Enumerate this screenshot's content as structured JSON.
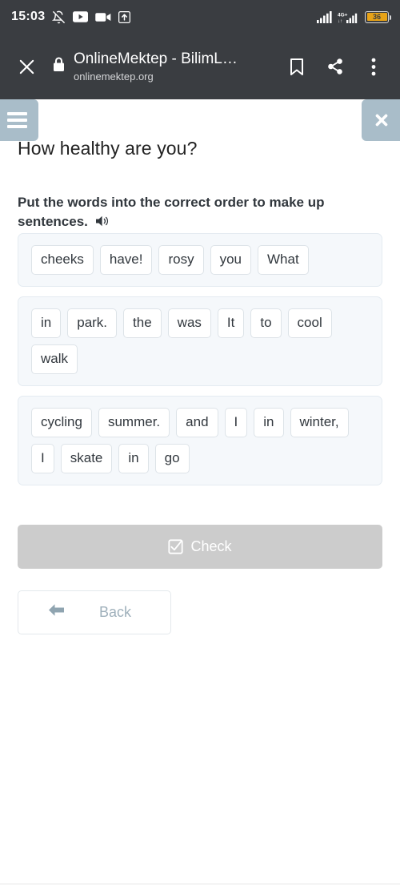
{
  "status_bar": {
    "clock": "15:03",
    "left_icons": [
      "bell-muted-icon",
      "youtube-icon",
      "video-camera-icon",
      "upload-arrow-icon"
    ],
    "right_icons": [
      "signal-bars-icon",
      "network-4g-plus-icon"
    ],
    "network_label": "4G+",
    "battery_percent": "36",
    "battery_color": "#e8a317"
  },
  "browser": {
    "close_icon": "close-icon",
    "lock_icon": "lock-icon",
    "page_title": "OnlineMektep - BilimL…",
    "page_url": "onlinemektep.org",
    "bookmark_icon": "bookmark-icon",
    "share_icon": "share-icon",
    "overflow_icon": "more-vertical-icon"
  },
  "app": {
    "menu_icon": "hamburger-menu-icon",
    "close_icon": "close-x-icon",
    "accent_color": "#a9bdc9",
    "lesson_title": "How healthy are you?",
    "instruction": "Put the words into the correct order to make up sentences.",
    "audio_icon": "speaker-icon"
  },
  "word_banks": [
    {
      "id": "sentence-1",
      "words": [
        "cheeks",
        "have!",
        "rosy",
        "you",
        "What"
      ]
    },
    {
      "id": "sentence-2",
      "words": [
        "in",
        "park.",
        "the",
        "was",
        "It",
        "to",
        "cool",
        "walk"
      ]
    },
    {
      "id": "sentence-3",
      "words": [
        "cycling",
        "summer.",
        "and",
        "I",
        "in",
        "winter,",
        "I",
        "skate",
        "in",
        "go"
      ]
    }
  ],
  "actions": {
    "check_label": "Check",
    "check_icon": "checkbox-checked-icon",
    "check_disabled_color": "#cccccc",
    "back_label": "Back",
    "back_icon": "arrow-left-icon"
  }
}
